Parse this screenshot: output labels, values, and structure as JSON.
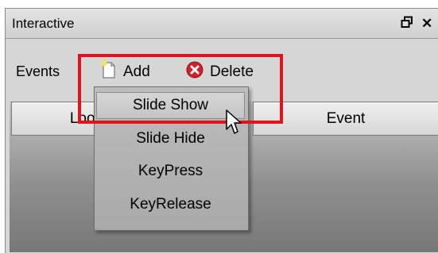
{
  "window": {
    "title": "Interactive",
    "restore_glyph": "🗗",
    "close_glyph": "✕"
  },
  "toolbar": {
    "events_label": "Events",
    "add_label": "Add",
    "delete_label": "Delete",
    "add_icon": "new-document-icon",
    "delete_icon": "red-circle-x-icon"
  },
  "table": {
    "columns": [
      "Loop",
      "Event"
    ]
  },
  "menu": {
    "items": [
      "Slide Show",
      "Slide Hide",
      "KeyPress",
      "KeyRelease"
    ],
    "hovered_index": 0
  },
  "colors": {
    "highlight": "#e0151c",
    "delete_icon": "#d21f2b"
  }
}
